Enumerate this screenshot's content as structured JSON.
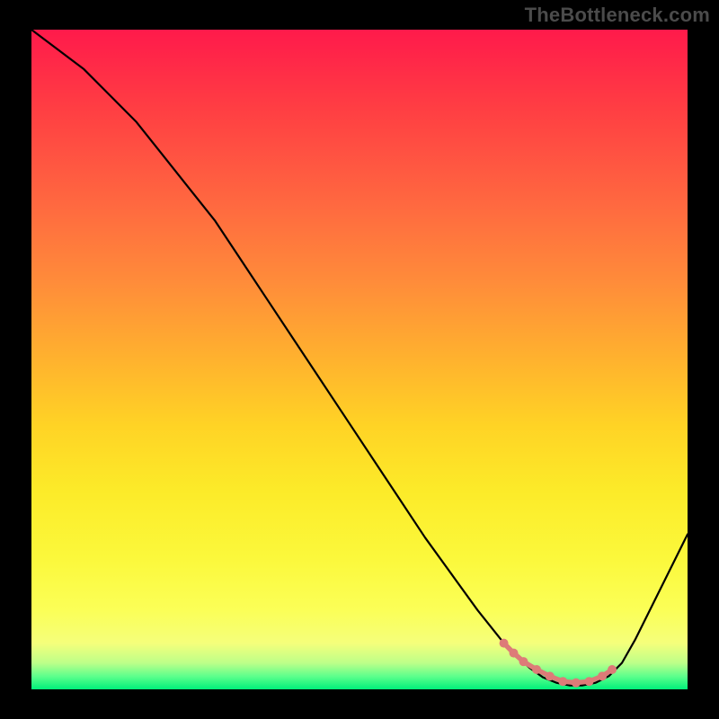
{
  "watermark": "TheBottleneck.com",
  "chart_data": {
    "type": "line",
    "title": "",
    "xlabel": "",
    "ylabel": "",
    "xlim": [
      0,
      100
    ],
    "ylim": [
      0,
      100
    ],
    "grid": false,
    "legend": false,
    "series": [
      {
        "name": "bottleneck-curve",
        "x": [
          0,
          4,
          8,
          12,
          16,
          20,
          24,
          28,
          32,
          36,
          40,
          44,
          48,
          52,
          56,
          60,
          64,
          68,
          72,
          74,
          76,
          78,
          80,
          82,
          84,
          86,
          88,
          90,
          92,
          94,
          96,
          98,
          100
        ],
        "y": [
          100,
          97,
          94,
          90,
          86,
          81,
          76,
          71,
          65,
          59,
          53,
          47,
          41,
          35,
          29,
          23,
          17.5,
          12,
          7,
          5,
          3.2,
          1.8,
          1.0,
          0.6,
          0.6,
          1.0,
          2.0,
          4.0,
          7.5,
          11.5,
          15.5,
          19.5,
          23.5
        ],
        "color": "#000000"
      },
      {
        "name": "highlight-dots",
        "x": [
          72,
          73.5,
          75,
          77,
          79,
          81,
          83,
          85,
          87,
          88.5
        ],
        "y": [
          7.0,
          5.5,
          4.2,
          3.0,
          2.0,
          1.2,
          1.0,
          1.2,
          2.0,
          3.0
        ],
        "color": "#dd7b78"
      }
    ],
    "gradient_stops": [
      {
        "pos": 0,
        "color": "#ff1a4b"
      },
      {
        "pos": 12,
        "color": "#ff3e43"
      },
      {
        "pos": 26,
        "color": "#ff6740"
      },
      {
        "pos": 38,
        "color": "#ff8b3a"
      },
      {
        "pos": 50,
        "color": "#ffb22e"
      },
      {
        "pos": 60,
        "color": "#ffd325"
      },
      {
        "pos": 70,
        "color": "#fceb29"
      },
      {
        "pos": 80,
        "color": "#fbf83b"
      },
      {
        "pos": 88,
        "color": "#fbff57"
      },
      {
        "pos": 93,
        "color": "#f5ff7b"
      },
      {
        "pos": 96,
        "color": "#bdff89"
      },
      {
        "pos": 98,
        "color": "#5eff8c"
      },
      {
        "pos": 100,
        "color": "#00f07a"
      }
    ]
  }
}
